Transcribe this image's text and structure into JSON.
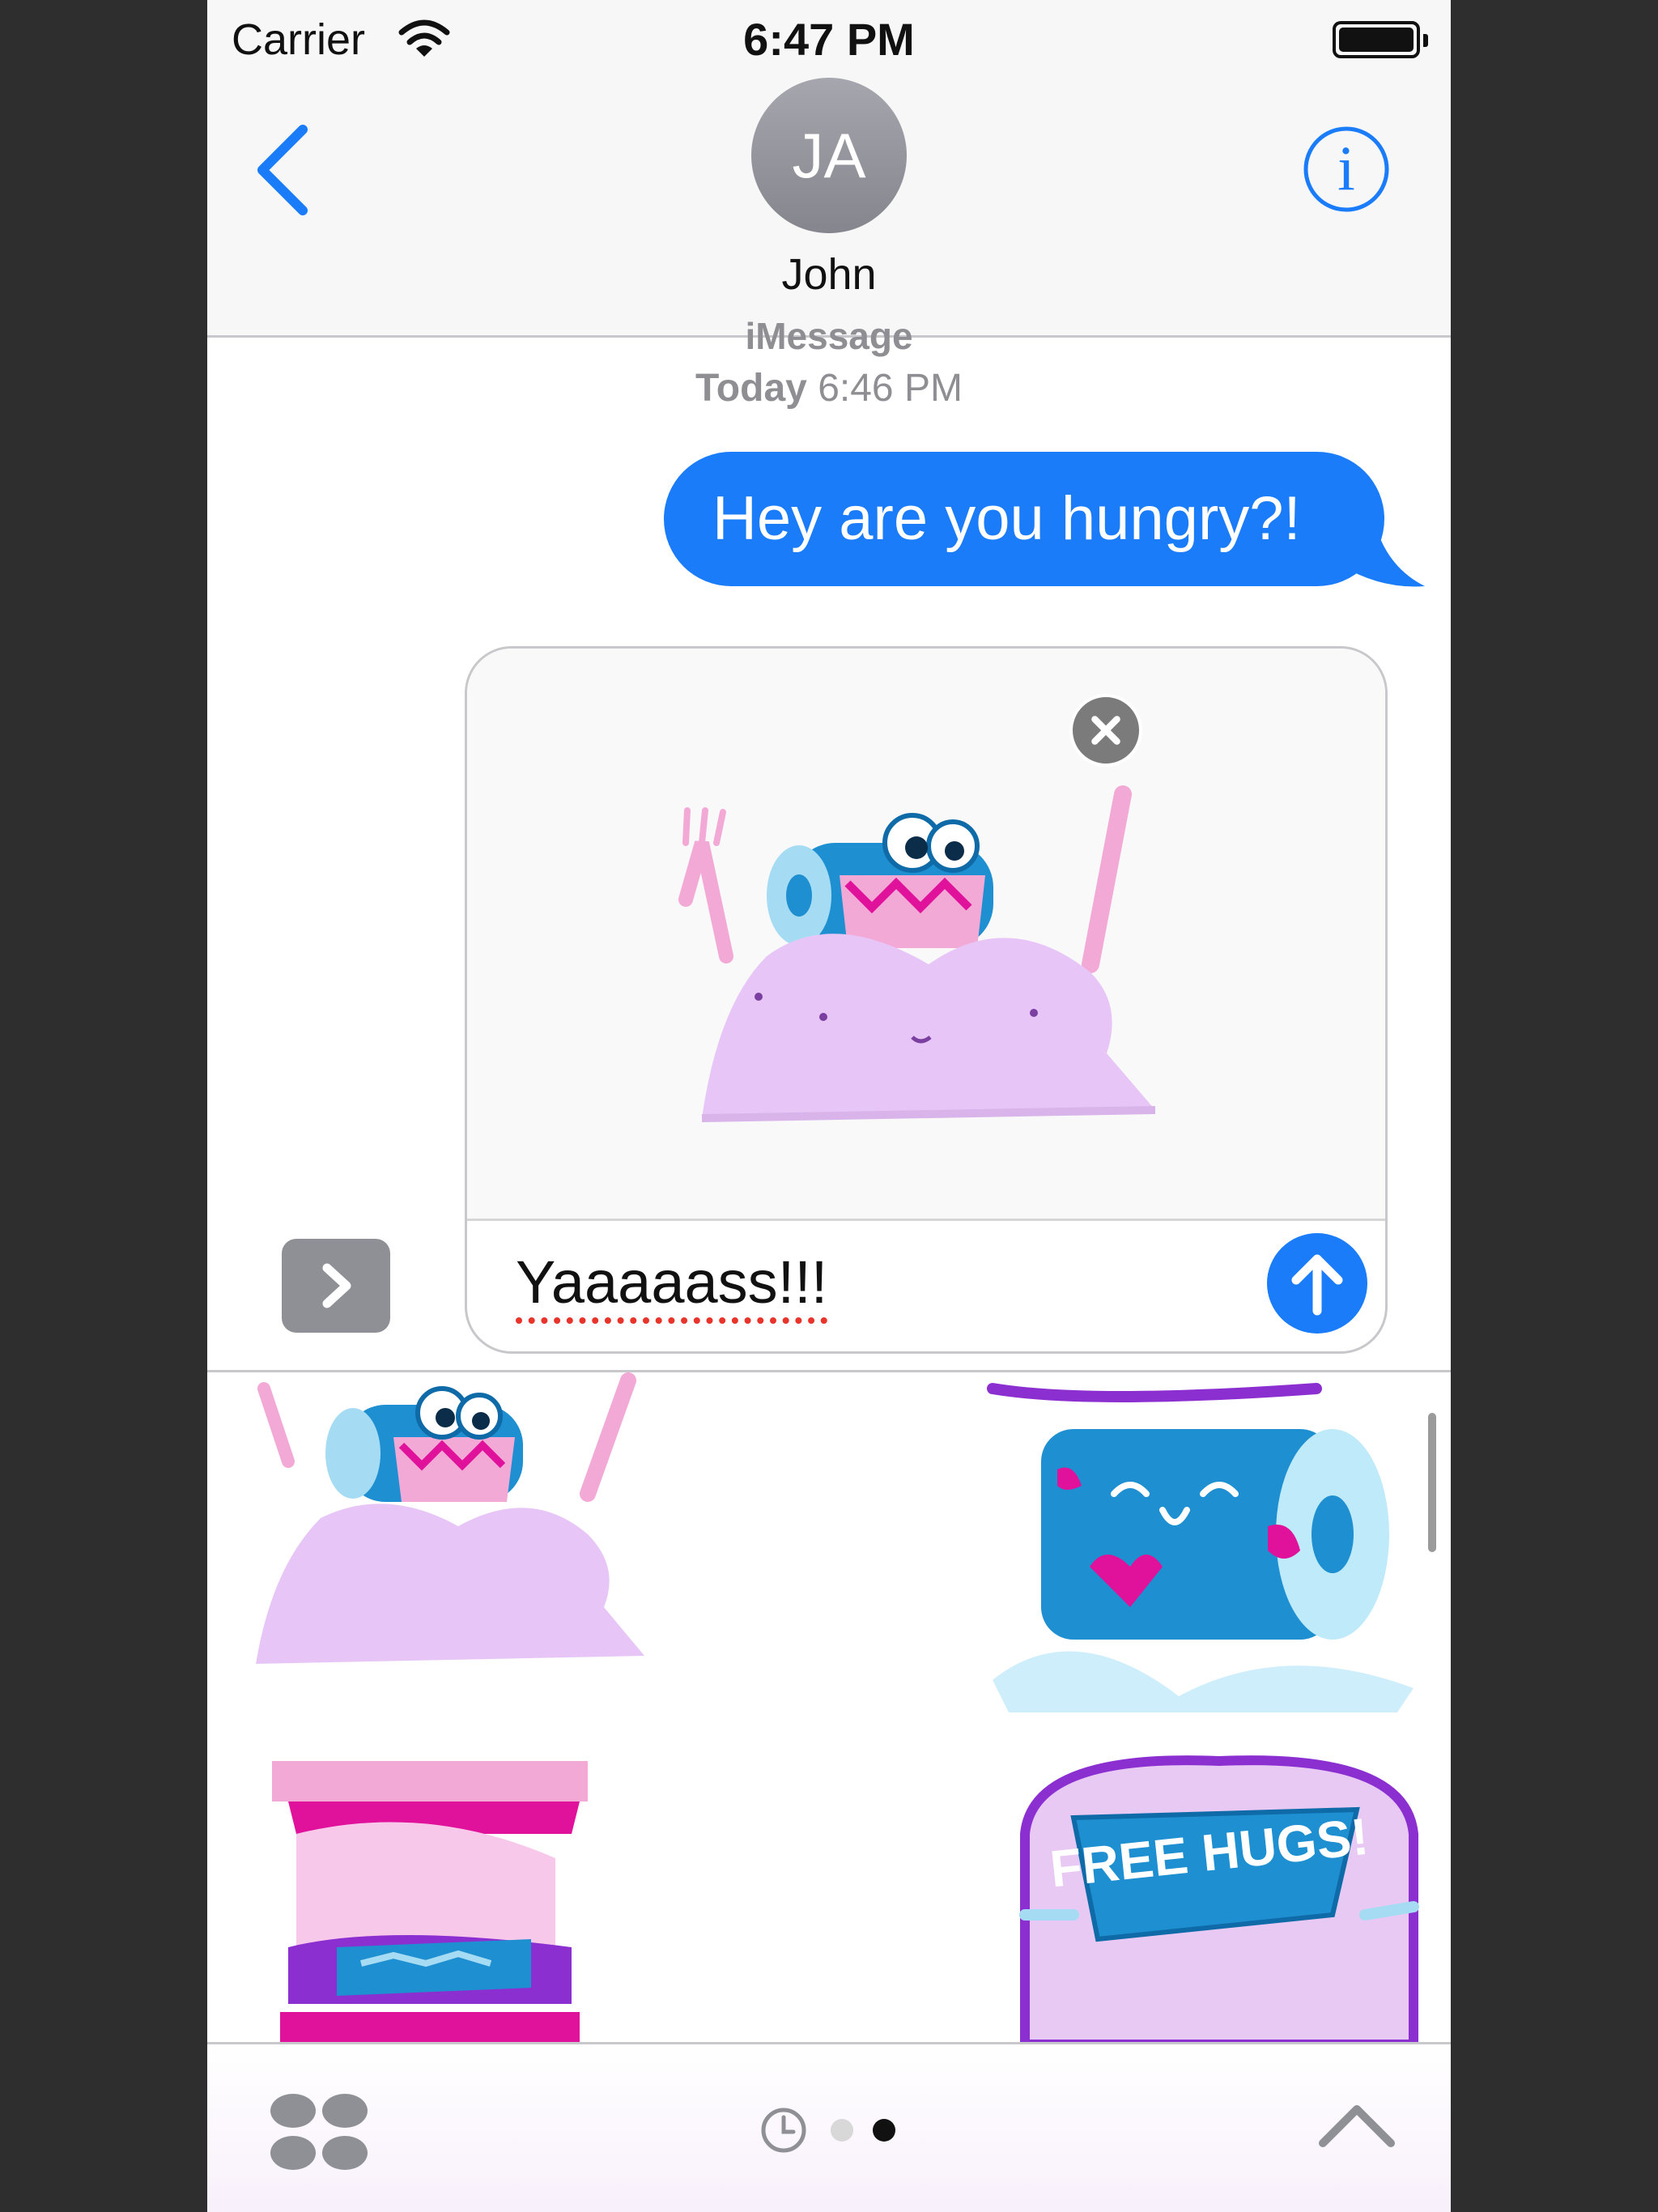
{
  "status_bar": {
    "carrier": "Carrier",
    "time": "6:47 PM"
  },
  "header": {
    "avatar_initials": "JA",
    "contact_name": "John"
  },
  "conversation": {
    "service": "iMessage",
    "date_label": "Today",
    "time_label": "6:46 PM",
    "messages": [
      {
        "from": "me",
        "text": "Hey are you hungry?!"
      }
    ]
  },
  "compose": {
    "text": "Yaaaaass!!!",
    "attached_sticker": "hungry-toilet-roll-sticker"
  },
  "sticker_drawer": {
    "stickers": [
      {
        "name": "hungry-toilet-roll-sticker"
      },
      {
        "name": "sleeping-toilet-roll-sticker"
      },
      {
        "name": "toast-sandwich-sticker"
      },
      {
        "name": "free-hugs-sticker",
        "text": "FREE HUGS!"
      }
    ],
    "page_indicator": {
      "pages": 2,
      "current": 2
    }
  },
  "colors": {
    "accent": "#1A7CF9",
    "sticker_purple": "#E7C6F7",
    "sticker_blue": "#1E8FD0",
    "sticker_magenta": "#E0129B"
  }
}
